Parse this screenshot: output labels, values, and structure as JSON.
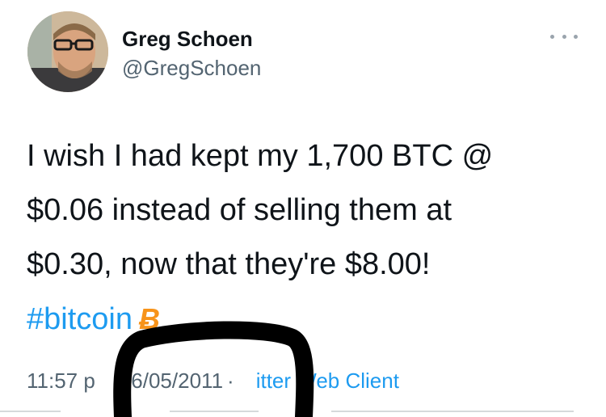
{
  "tweet": {
    "author": {
      "display_name": "Greg Schoen",
      "handle": "@GregSchoen"
    },
    "more_icon": "more-dots-icon",
    "text_lines": [
      "I wish I had kept my 1,700 BTC @",
      "$0.06 instead of selling them at",
      "$0.30, now that they're $8.00!"
    ],
    "hashtag": "#bitcoin",
    "hashtag_icon": "bitcoin-icon",
    "hashtag_icon_glyph": "Ƀ",
    "meta": {
      "time": "11:57 p",
      "date": "16/05/2011",
      "separator": "·",
      "source": "itter Web Client"
    },
    "colors": {
      "link": "#1d9bf0",
      "text": "#0f1419",
      "secondary": "#536471",
      "bitcoin": "#f7931a",
      "scribble": "#000000"
    }
  }
}
